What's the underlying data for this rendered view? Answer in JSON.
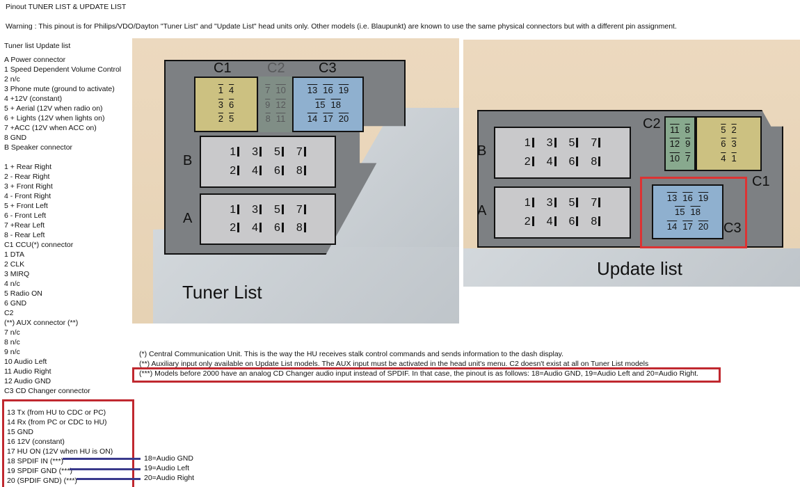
{
  "title": "Pinout TUNER LIST & UPDATE LIST",
  "warning": "Warning : This pinout is for Philips/VDO/Dayton \"Tuner List\" and \"Update List\" head units only. Other models (i.e. Blaupunkt) are known to use the same physical connectors but with a different pin assignment.",
  "list_header": "Tuner list   Update list",
  "pin_list": [
    " A Power  connector",
    "1 Speed Dependent Volume Control",
    "2 n/c",
    "3 Phone mute (ground to activate)",
    "4 +12V (constant)",
    "5 + Aerial (12V when radio on)",
    "6 + Lights (12V when lights on)",
    "7 +ACC (12V when ACC on)",
    "8 GND",
    "B Speaker connector",
    "",
    "1 + Rear Right",
    "2 - Rear Right",
    "3 + Front Right",
    "4 - Front Right",
    "5 + Front Left",
    "6 - Front Left",
    "7 +Rear Left",
    "8 - Rear Left",
    "C1 CCU(*) connector",
    "1 DTA",
    "2 CLK",
    "3 MIRQ",
    "4 n/c",
    "5 Radio ON",
    "6 GND",
    "C2",
    "(**) AUX connector (**)",
    "7 n/c",
    "8 n/c",
    "9 n/c",
    "10 Audio Left",
    "11 Audio Right",
    "12 Audio GND",
    "C3 CD Changer connector"
  ],
  "cd_changer_pins": [
    "13 Tx (from HU to CDC or PC)",
    "14 Rx (from PC or CDC to HU)",
    "15 GND",
    "16 12V (constant)",
    "17 HU ON (12V when HU is ON)",
    "18 SPDIF IN (***)",
    "19 SPDIF GND (***)",
    "20 (SPDIF GND) (***)"
  ],
  "analog_alternates": [
    "18=Audio GND",
    "19=Audio Left",
    "20=Audio Right"
  ],
  "footnotes": [
    "(*) Central Communication Unit. This is the way the HU receives stalk control commands and sends information to the dash display.",
    "(**) Auxiliary input only available on Update List models. The AUX input must be activated in the head unit's menu. C2 doesn't exist at all on Tuner List models",
    "(***) Models before 2000 have an analog CD Changer audio input instead of SPDIF. In that case, the pinout is as follows: 18=Audio GND, 19=Audio Left and 20=Audio Right."
  ],
  "highlight_color": "#c0282f",
  "tuner": {
    "caption": "Tuner List",
    "connectors": {
      "c1": {
        "label": "C1",
        "rows": [
          [
            "1",
            "4"
          ],
          [
            "3",
            "6"
          ],
          [
            "2",
            "5"
          ]
        ]
      },
      "c2": {
        "label": "C2",
        "rows": [
          [
            "7",
            "10"
          ],
          [
            "9",
            "12"
          ],
          [
            "8",
            "11"
          ]
        ]
      },
      "c3": {
        "label": "C3",
        "rows": [
          [
            "13",
            "16",
            "19"
          ],
          [
            "15",
            "18"
          ],
          [
            "14",
            "17",
            "20"
          ]
        ]
      },
      "b": {
        "label": "B",
        "rows": [
          [
            "1",
            "3",
            "5",
            "7"
          ],
          [
            "2",
            "4",
            "6",
            "8"
          ]
        ]
      },
      "a": {
        "label": "A",
        "rows": [
          [
            "1",
            "3",
            "5",
            "7"
          ],
          [
            "2",
            "4",
            "6",
            "8"
          ]
        ]
      }
    }
  },
  "update": {
    "caption": "Update list",
    "connectors": {
      "c2": {
        "label": "C2",
        "rows": [
          [
            "11",
            "8"
          ],
          [
            "12",
            "9"
          ],
          [
            "10",
            "7"
          ]
        ]
      },
      "c1": {
        "label": "C1",
        "rows": [
          [
            "5",
            "2"
          ],
          [
            "6",
            "3"
          ],
          [
            "4",
            "1"
          ]
        ]
      },
      "c3": {
        "label": "C3",
        "rows": [
          [
            "13",
            "16",
            "19"
          ],
          [
            "15",
            "18"
          ],
          [
            "14",
            "17",
            "20"
          ]
        ]
      },
      "b": {
        "label": "B",
        "rows": [
          [
            "1",
            "3",
            "5",
            "7"
          ],
          [
            "2",
            "4",
            "6",
            "8"
          ]
        ]
      },
      "a": {
        "label": "A",
        "rows": [
          [
            "1",
            "3",
            "5",
            "7"
          ],
          [
            "2",
            "4",
            "6",
            "8"
          ]
        ]
      }
    }
  }
}
